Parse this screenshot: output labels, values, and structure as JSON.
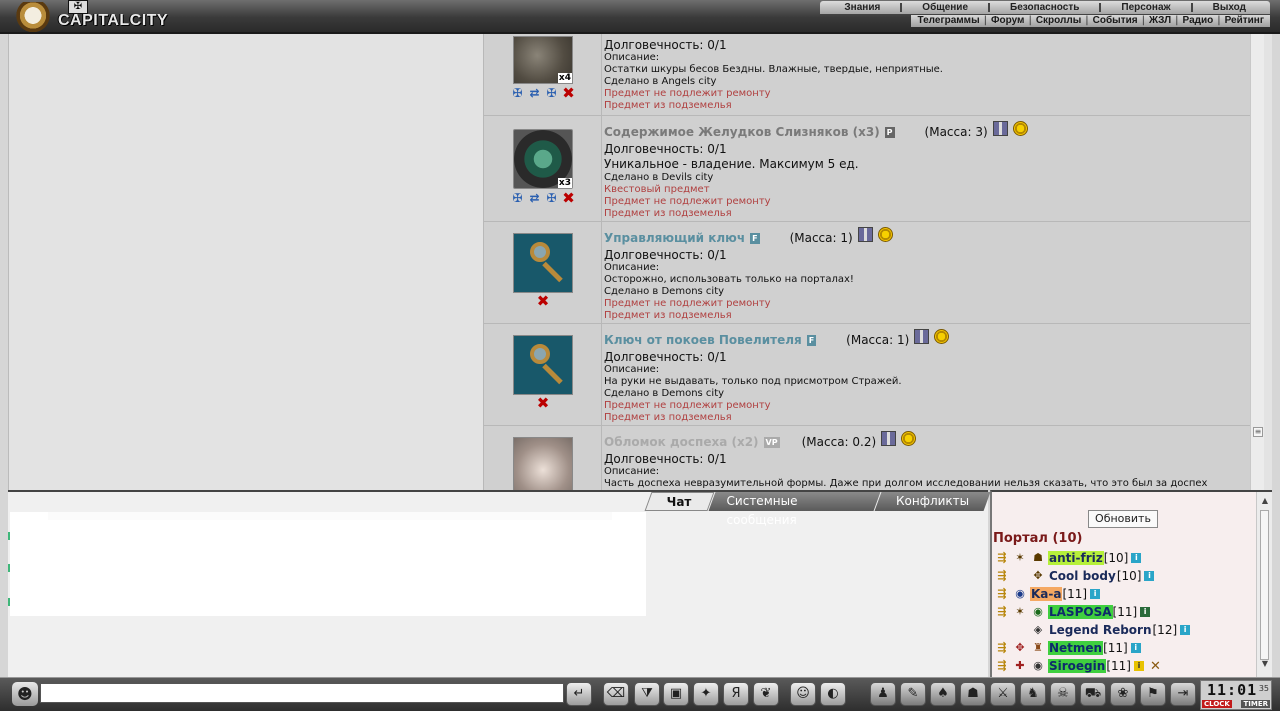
{
  "app": {
    "logo_text": "CAPITALCITY"
  },
  "main_menu": [
    "Знания",
    "Общение",
    "Безопасность",
    "Персонаж",
    "Выход"
  ],
  "sub_menu": [
    "Телеграммы",
    "Форум",
    "Скроллы",
    "События",
    "ЖЗЛ",
    "Радио",
    "Рейтинг"
  ],
  "items": [
    {
      "name": "",
      "count": "x4",
      "lines": [
        {
          "text": "Долговечность: 0/1",
          "size": "12",
          "color": "normal"
        },
        {
          "text": "Описание:",
          "size": "10",
          "color": "normal"
        },
        {
          "text": "Остатки шкуры бесов Бездны. Влажные, твердые, неприятные.",
          "size": "10",
          "color": "normal"
        },
        {
          "text": "Сделано в Angels city",
          "size": "10",
          "color": "normal"
        },
        {
          "text": "Предмет не подлежит ремонту",
          "size": "10",
          "color": "red"
        },
        {
          "text": "Предмет из подземелья",
          "size": "10",
          "color": "red"
        }
      ]
    },
    {
      "name": "Содержимое Желудков Слизняков (x3)",
      "tag": "P",
      "mass": "(Масса: 3)",
      "count": "x3",
      "lines": [
        {
          "text": "Долговечность: 0/1",
          "size": "12",
          "color": "normal"
        },
        {
          "text": "Уникальное - владение. Максимум 5 ед.",
          "size": "12",
          "color": "normal"
        },
        {
          "text": "Сделано в Devils city",
          "size": "10",
          "color": "normal"
        },
        {
          "text": "Квестовый предмет",
          "size": "10",
          "color": "red"
        },
        {
          "text": "Предмет не подлежит ремонту",
          "size": "10",
          "color": "red"
        },
        {
          "text": "Предмет из подземелья",
          "size": "10",
          "color": "red"
        }
      ]
    },
    {
      "name": "Управляющий ключ",
      "tag": "F",
      "mass": "(Масса: 1)",
      "lines": [
        {
          "text": "Долговечность: 0/1",
          "size": "12",
          "color": "normal"
        },
        {
          "text": "Описание:",
          "size": "10",
          "color": "normal"
        },
        {
          "text": "Осторожно, использовать только на порталах!",
          "size": "10",
          "color": "normal"
        },
        {
          "text": "Сделано в Demons city",
          "size": "10",
          "color": "normal"
        },
        {
          "text": "Предмет не подлежит ремонту",
          "size": "10",
          "color": "red"
        },
        {
          "text": "Предмет из подземелья",
          "size": "10",
          "color": "red"
        }
      ]
    },
    {
      "name": "Ключ от покоев Повелителя",
      "tag": "F",
      "mass": "(Масса: 1)",
      "lines": [
        {
          "text": "Долговечность: 0/1",
          "size": "12",
          "color": "normal"
        },
        {
          "text": "Описание:",
          "size": "10",
          "color": "normal"
        },
        {
          "text": "На руки не выдавать, только под присмотром Стражей.",
          "size": "10",
          "color": "normal"
        },
        {
          "text": "Сделано в Demons city",
          "size": "10",
          "color": "normal"
        },
        {
          "text": "Предмет не подлежит ремонту",
          "size": "10",
          "color": "red"
        },
        {
          "text": "Предмет из подземелья",
          "size": "10",
          "color": "red"
        }
      ]
    },
    {
      "name": "Обломок доспеха (x2)",
      "tag": "VP",
      "mass": "(Масса: 0.2)",
      "lines": [
        {
          "text": "Долговечность: 0/1",
          "size": "12",
          "color": "normal"
        },
        {
          "text": "Описание:",
          "size": "10",
          "color": "normal"
        },
        {
          "text": "Часть доспеха невразумительной формы. Даже при долгом исследовании нельзя сказать, что это был за доспех",
          "size": "10",
          "color": "normal"
        }
      ]
    }
  ],
  "chat": {
    "tabs": [
      "Чат",
      "Системные сообщения",
      "Конфликты"
    ],
    "input_value": ""
  },
  "users": {
    "refresh_label": "Обновить",
    "room_title": "Портал (10)",
    "list": [
      {
        "name": "anti-friz",
        "level": "[10]"
      },
      {
        "name": "Cool body",
        "level": "[10]"
      },
      {
        "name": "Ka-a",
        "level": "[11]"
      },
      {
        "name": "LASPOSA",
        "level": "[11]"
      },
      {
        "name": "Legend Reborn",
        "level": "[12]"
      },
      {
        "name": "Netmen",
        "level": "[11]"
      },
      {
        "name": "Siroegin",
        "level": "[11]"
      }
    ]
  },
  "clock": {
    "time": "11:01",
    "seconds": "35",
    "label_clock": "CLOCK",
    "label_timer": "TIMER"
  },
  "icons": {
    "action_repair": "gear-cross-icon",
    "action_transfer": "arrows-icon",
    "action_delete": "red-x-icon",
    "gift": "gift-box-icon",
    "coin": "gold-coin-icon",
    "info": "info-icon"
  },
  "colors": {
    "item_name_gray": "#7a7a7a",
    "item_name_teal": "#5a8fa0",
    "red_note": "#b04040",
    "user_lime": "#b6f03a",
    "user_green": "#3fcf3f",
    "user_orange": "#f5a862",
    "room_title": "#7a1a1a"
  }
}
